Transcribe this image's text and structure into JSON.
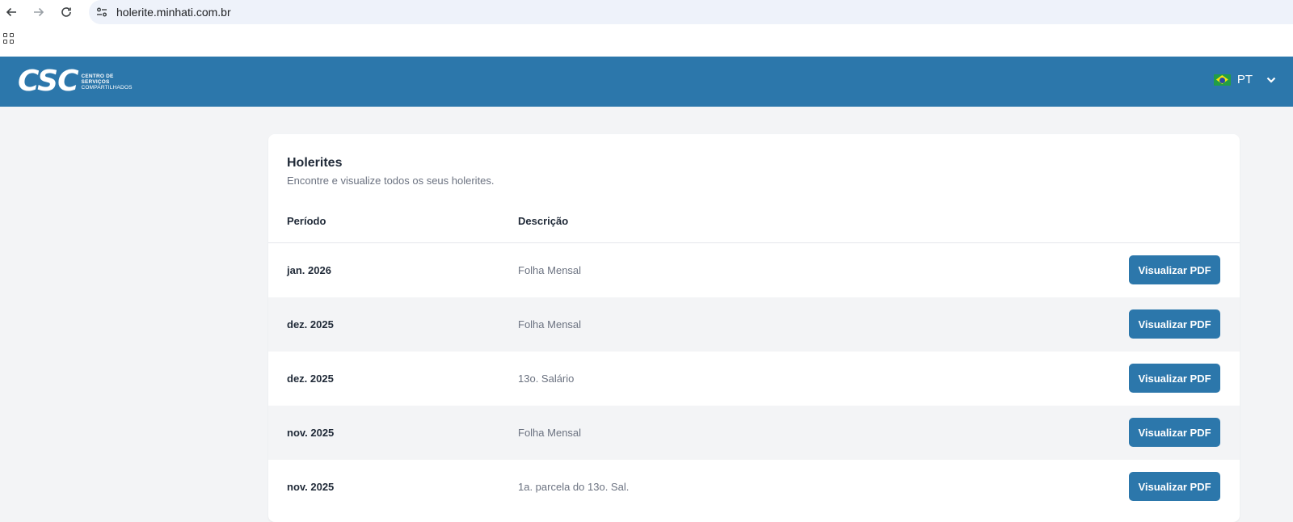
{
  "browser": {
    "url": "holerite.minhati.com.br"
  },
  "header": {
    "logo_main": "CSC",
    "logo_line1": "CENTRO DE",
    "logo_line2": "SERVIÇOS",
    "logo_line3": "COMPARTILHADOS",
    "language": "PT"
  },
  "card": {
    "title": "Holerites",
    "subtitle": "Encontre e visualize todos os seus holerites.",
    "columns": [
      "Período",
      "Descrição"
    ],
    "rows": [
      {
        "period": "jan. 2026",
        "description": "Folha Mensal",
        "action": "Visualizar PDF"
      },
      {
        "period": "dez. 2025",
        "description": "Folha Mensal",
        "action": "Visualizar PDF"
      },
      {
        "period": "dez. 2025",
        "description": "13o. Salário",
        "action": "Visualizar PDF"
      },
      {
        "period": "nov. 2025",
        "description": "Folha Mensal",
        "action": "Visualizar PDF"
      },
      {
        "period": "nov. 2025",
        "description": "1a. parcela do 13o. Sal.",
        "action": "Visualizar PDF"
      }
    ]
  },
  "colors": {
    "brand": "#2c77ab",
    "page_bg": "#f3f4f6",
    "text_dark": "#1f2937",
    "text_muted": "#6b7280"
  },
  "icons": [
    "back-arrow-icon",
    "forward-arrow-icon",
    "reload-icon",
    "site-info-icon",
    "apps-grid-icon",
    "brazil-flag-icon",
    "chevron-down-icon"
  ]
}
